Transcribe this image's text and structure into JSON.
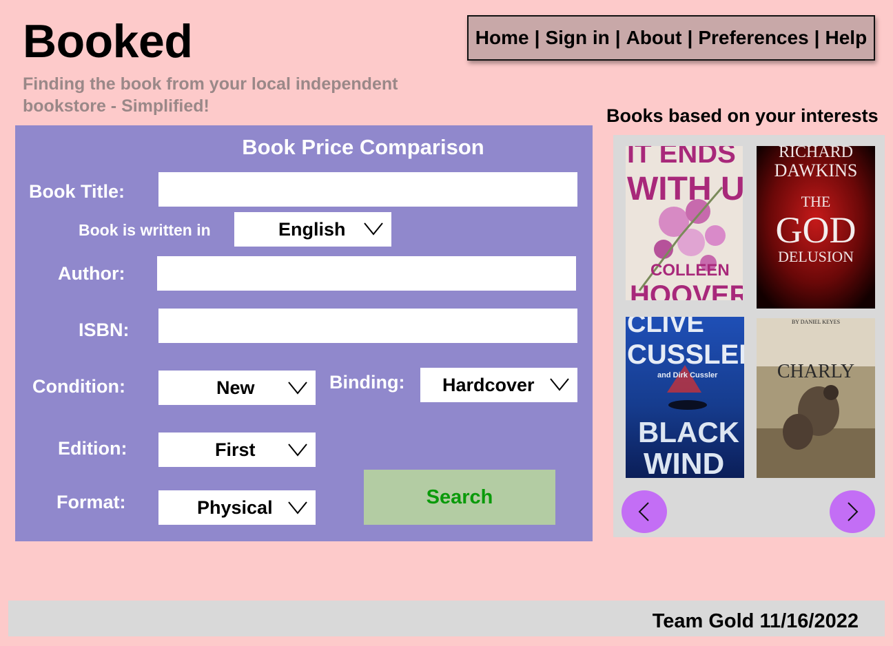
{
  "header": {
    "logo": "Booked",
    "tagline": "Finding the book from your local independent bookstore - Simplified!"
  },
  "nav": {
    "items": [
      "Home",
      "Sign in",
      "About",
      "Preferences",
      "Help"
    ],
    "separator": "|"
  },
  "form": {
    "title": "Book Price Comparison",
    "book_title_label": "Book Title:",
    "book_title_value": "",
    "language_label": "Book is written in",
    "language_value": "English",
    "author_label": "Author:",
    "author_value": "",
    "isbn_label": "ISBN:",
    "isbn_value": "",
    "condition_label": "Condition:",
    "condition_value": "New",
    "binding_label": "Binding:",
    "binding_value": "Hardcover",
    "edition_label": "Edition:",
    "edition_value": "First",
    "format_label": "Format:",
    "format_value": "Physical",
    "search_label": "Search"
  },
  "recommendations": {
    "title": "Books based on your interests",
    "books": [
      {
        "cover_top": "IT ENDS",
        "cover_mid": "WITH US",
        "cover_author": "COLLEEN",
        "cover_author2": "HOOVER"
      },
      {
        "cover_author": "RICHARD",
        "cover_author2": "DAWKINS",
        "cover_pre": "THE",
        "cover_top": "GOD",
        "cover_mid": "DELUSION"
      },
      {
        "cover_author": "CLIVE",
        "cover_author2": "CUSSLER",
        "cover_sub": "and Dirk Cussler",
        "cover_top": "BLACK",
        "cover_mid": "WIND"
      },
      {
        "cover_author": "BY DANIEL KEYES",
        "cover_top": "CHARLY"
      }
    ],
    "prev_icon": "chevron-left-icon",
    "next_icon": "chevron-right-icon"
  },
  "footer": {
    "text": "Team Gold 11/16/2022"
  },
  "colors": {
    "background": "#fdcaca",
    "panel": "#9088cc",
    "nav": "#c8a8a8",
    "search_button": "#b3cca3",
    "search_text": "#0a9a0a",
    "carousel": "#d9d9d9",
    "arrow_button": "#c36ef5"
  }
}
